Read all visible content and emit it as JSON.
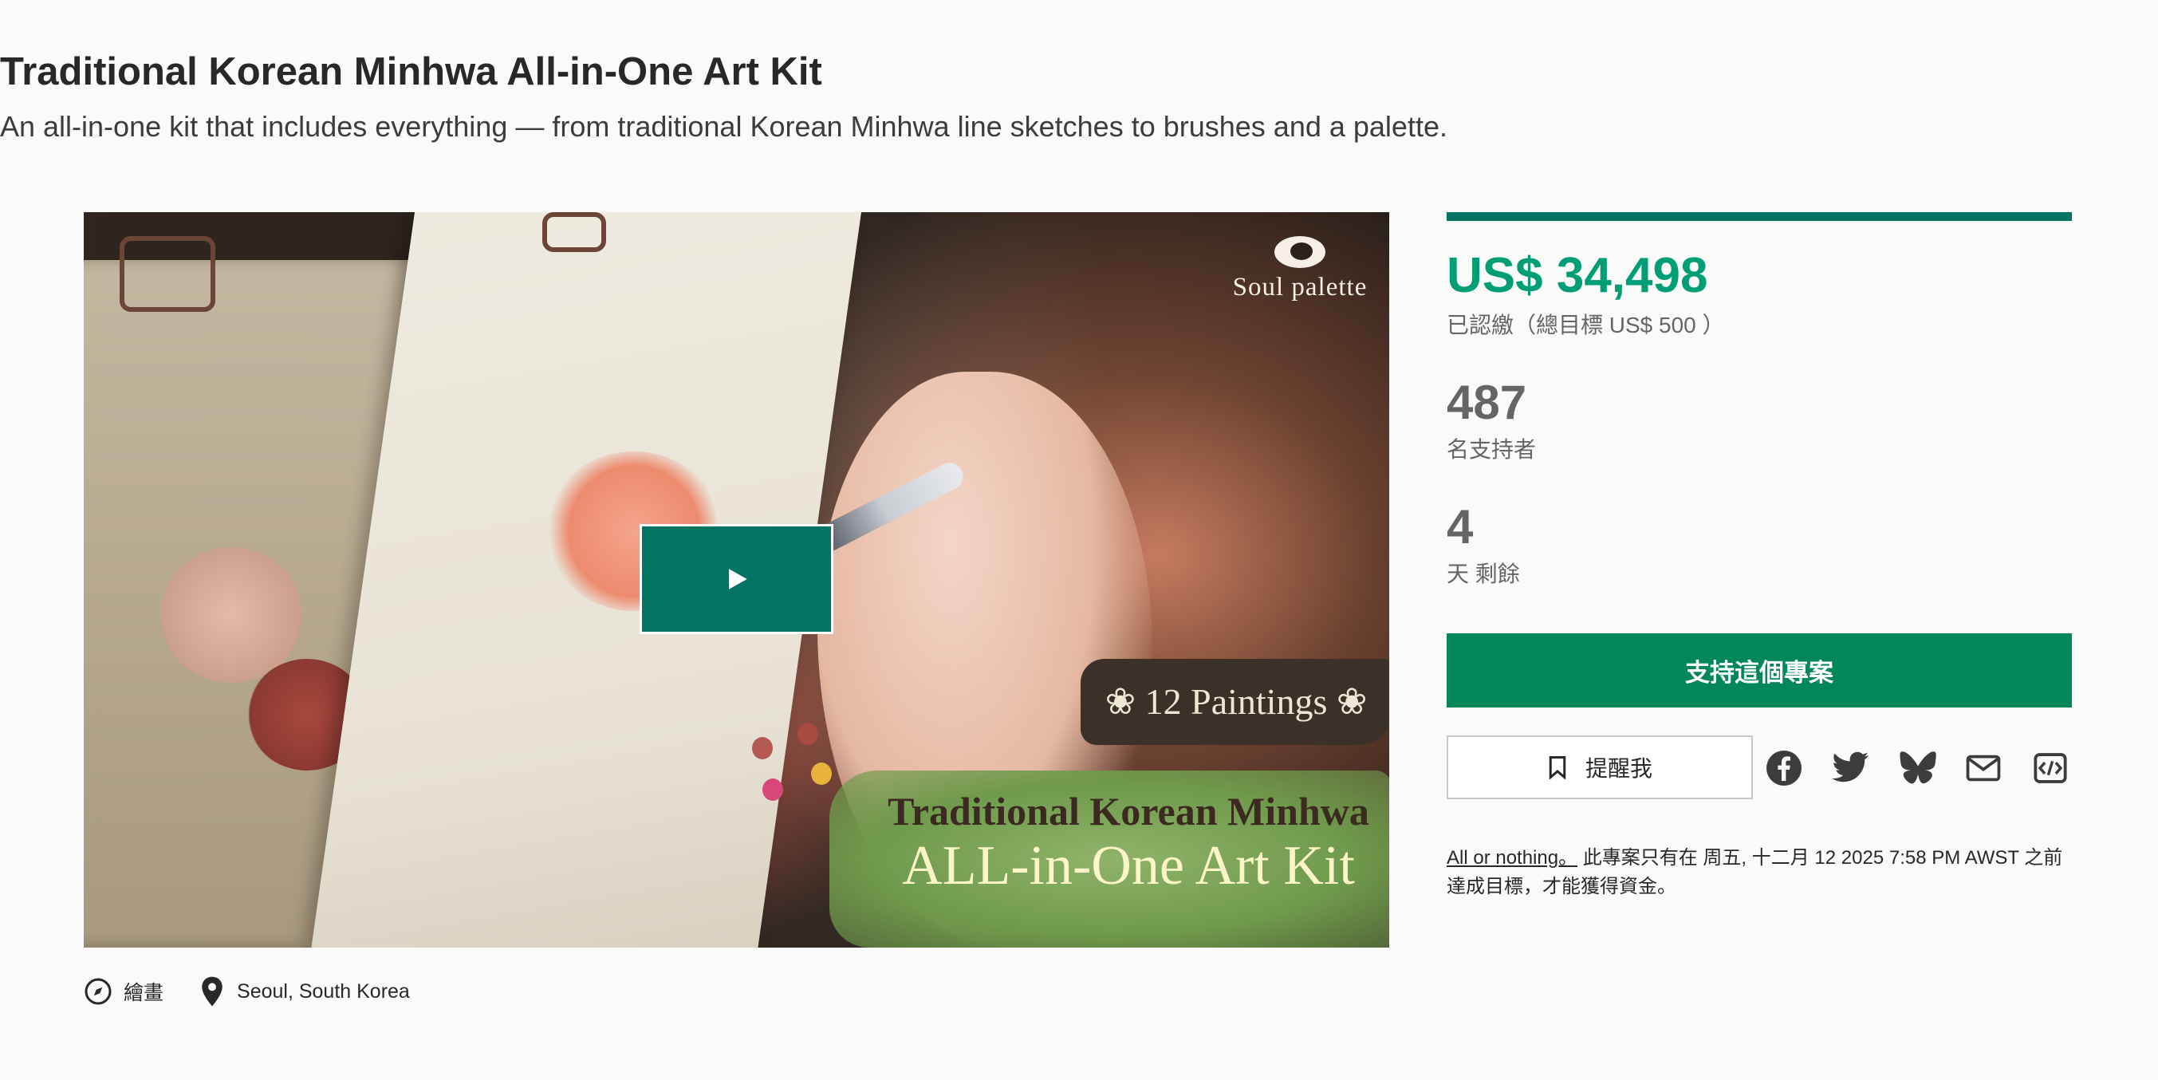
{
  "project": {
    "title": "Traditional Korean Minhwa All-in-One Art Kit",
    "subtitle": "An all-in-one kit that includes everything — from traditional Korean Minhwa line sketches to brushes and a palette."
  },
  "video": {
    "brand": "Soul palette",
    "banner_count": "❀ 12 Paintings ❀",
    "banner_line1": "Traditional Korean Minhwa",
    "banner_line2": "ALL-in-One Art Kit",
    "play_icon": "play-icon"
  },
  "meta": {
    "category": "繪畫",
    "category_icon": "compass-icon",
    "location": "Seoul, South Korea",
    "location_icon": "map-pin-icon"
  },
  "stats": {
    "progress_fraction": 1.0,
    "pledged": "US$ 34,498",
    "goal_text": "已認繳（總目標 US$ 500 ）",
    "backers": "487",
    "backers_label": "名支持者",
    "days": "4",
    "days_label": "天 剩餘"
  },
  "actions": {
    "back_label": "支持這個專案",
    "remind_label": "提醒我",
    "remind_icon": "bookmark-icon",
    "share_icons": [
      "facebook-icon",
      "twitter-icon",
      "bluesky-icon",
      "email-icon",
      "embed-icon"
    ]
  },
  "fineprint": {
    "link": "All or nothing。",
    "text": " 此專案只有在 周五, 十二月 12 2025 7:58 PM AWST 之前達成目標，才能獲得資金。"
  },
  "colors": {
    "accent_green": "#028858",
    "pledged_green": "#009e74",
    "play_teal": "#037362",
    "muted_text": "#656565"
  }
}
